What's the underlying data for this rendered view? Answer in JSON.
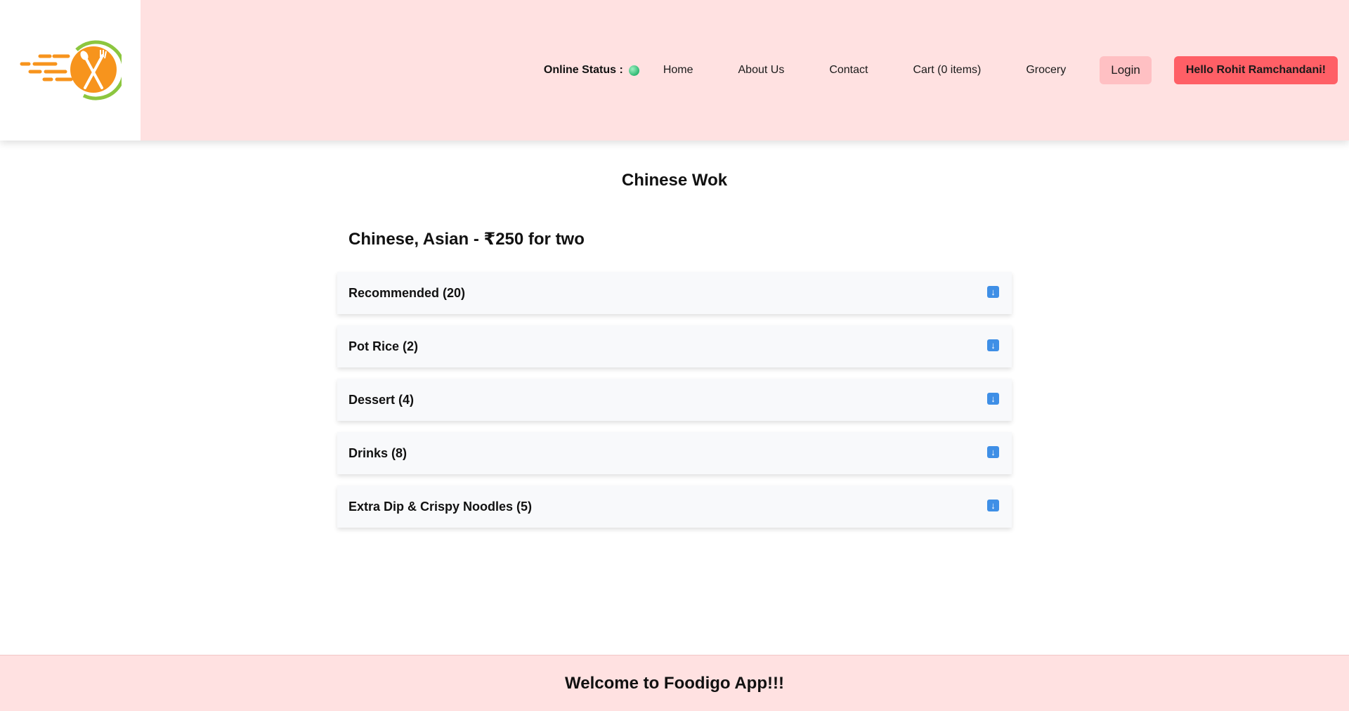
{
  "header": {
    "logo_icon": "fast-delivery-fork-spoon-logo",
    "online_status_label": "Online Status :",
    "online_status_color": "#2eb872",
    "nav": {
      "home": "Home",
      "about": "About Us",
      "contact": "Contact",
      "cart": "Cart (0 items)",
      "grocery": "Grocery"
    },
    "login_label": "Login",
    "user_greeting": "Hello Rohit Ramchandani!"
  },
  "restaurant": {
    "name": "Chinese Wok",
    "cuisine_price": "Chinese, Asian - ₹250 for two"
  },
  "categories": [
    {
      "label": "Recommended (20)",
      "icon": "down-arrow-icon"
    },
    {
      "label": "Pot Rice (2)",
      "icon": "down-arrow-icon"
    },
    {
      "label": "Dessert (4)",
      "icon": "down-arrow-icon"
    },
    {
      "label": "Drinks (8)",
      "icon": "down-arrow-icon"
    },
    {
      "label": "Extra Dip & Crispy Noodles (5)",
      "icon": "down-arrow-icon"
    }
  ],
  "footer": {
    "text": "Welcome to Foodigo App!!!"
  },
  "colors": {
    "header_bg": "#ffe1e1",
    "login_bg": "#ffc0c3",
    "greeting_bg": "#ff5f66",
    "accent_orange": "#f7941d",
    "accent_green": "#8cc63f",
    "arrow_blue": "#3f8fe6"
  }
}
